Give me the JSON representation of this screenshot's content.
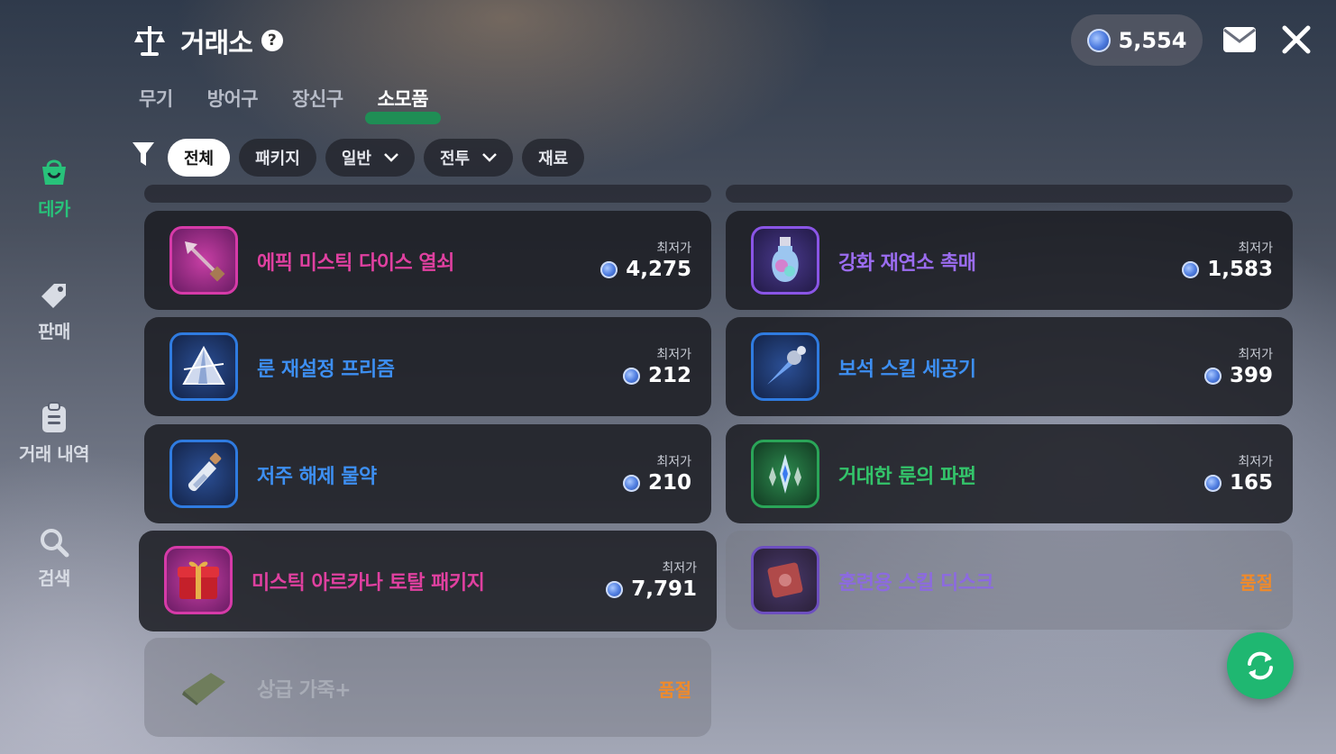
{
  "header": {
    "title": "거래소",
    "help_icon": "?"
  },
  "balance": {
    "amount": "5,554"
  },
  "tabs": [
    {
      "label": "무기",
      "active": false
    },
    {
      "label": "방어구",
      "active": false
    },
    {
      "label": "장신구",
      "active": false
    },
    {
      "label": "소모품",
      "active": true
    }
  ],
  "filters": [
    {
      "label": "전체",
      "active": true,
      "dropdown": false
    },
    {
      "label": "패키지",
      "active": false,
      "dropdown": false
    },
    {
      "label": "일반",
      "active": false,
      "dropdown": true
    },
    {
      "label": "전투",
      "active": false,
      "dropdown": true
    },
    {
      "label": "재료",
      "active": false,
      "dropdown": false
    }
  ],
  "sidebar": [
    {
      "label": "데카",
      "icon": "shopping-bag-icon",
      "active": true
    },
    {
      "label": "판매",
      "icon": "price-tag-icon",
      "active": false
    },
    {
      "label": "거래 내역",
      "icon": "clipboard-icon",
      "active": false
    },
    {
      "label": "검색",
      "icon": "search-icon",
      "active": false
    }
  ],
  "price_label": "최저가",
  "soldout_label": "품절",
  "items": [
    {
      "name": "에픽 미스틱 다이스 열쇠",
      "price": "4,275",
      "sold_out": false,
      "name_color": "#e040a0",
      "frame_color": "#d63aa8"
    },
    {
      "name": "강화 재연소 촉매",
      "price": "1,583",
      "sold_out": false,
      "name_color": "#9b6cf0",
      "frame_color": "#8a55e6"
    },
    {
      "name": "룬 재설정 프리즘",
      "price": "212",
      "sold_out": false,
      "name_color": "#3d8ff2",
      "frame_color": "#2f7be0"
    },
    {
      "name": "보석 스킬 세공기",
      "price": "399",
      "sold_out": false,
      "name_color": "#3d8ff2",
      "frame_color": "#2f7be0"
    },
    {
      "name": "저주 해제 물약",
      "price": "210",
      "sold_out": false,
      "name_color": "#3d8ff2",
      "frame_color": "#2f7be0"
    },
    {
      "name": "거대한 룬의 파편",
      "price": "165",
      "sold_out": false,
      "name_color": "#33c46a",
      "frame_color": "#2aa558"
    },
    {
      "name": "미스틱 아르카나 토탈 패키지",
      "price": "7,791",
      "sold_out": false,
      "name_color": "#e040a0",
      "frame_color": "#d63aa8"
    },
    {
      "name": "훈련용 스킬 디스크",
      "price": "",
      "sold_out": true,
      "name_color": "#8c6ae0",
      "frame_color": "#6d4fbf"
    },
    {
      "name": "상급 가죽+",
      "price": "",
      "sold_out": true,
      "name_color": "#a8acb6",
      "frame_color": "transparent"
    }
  ]
}
